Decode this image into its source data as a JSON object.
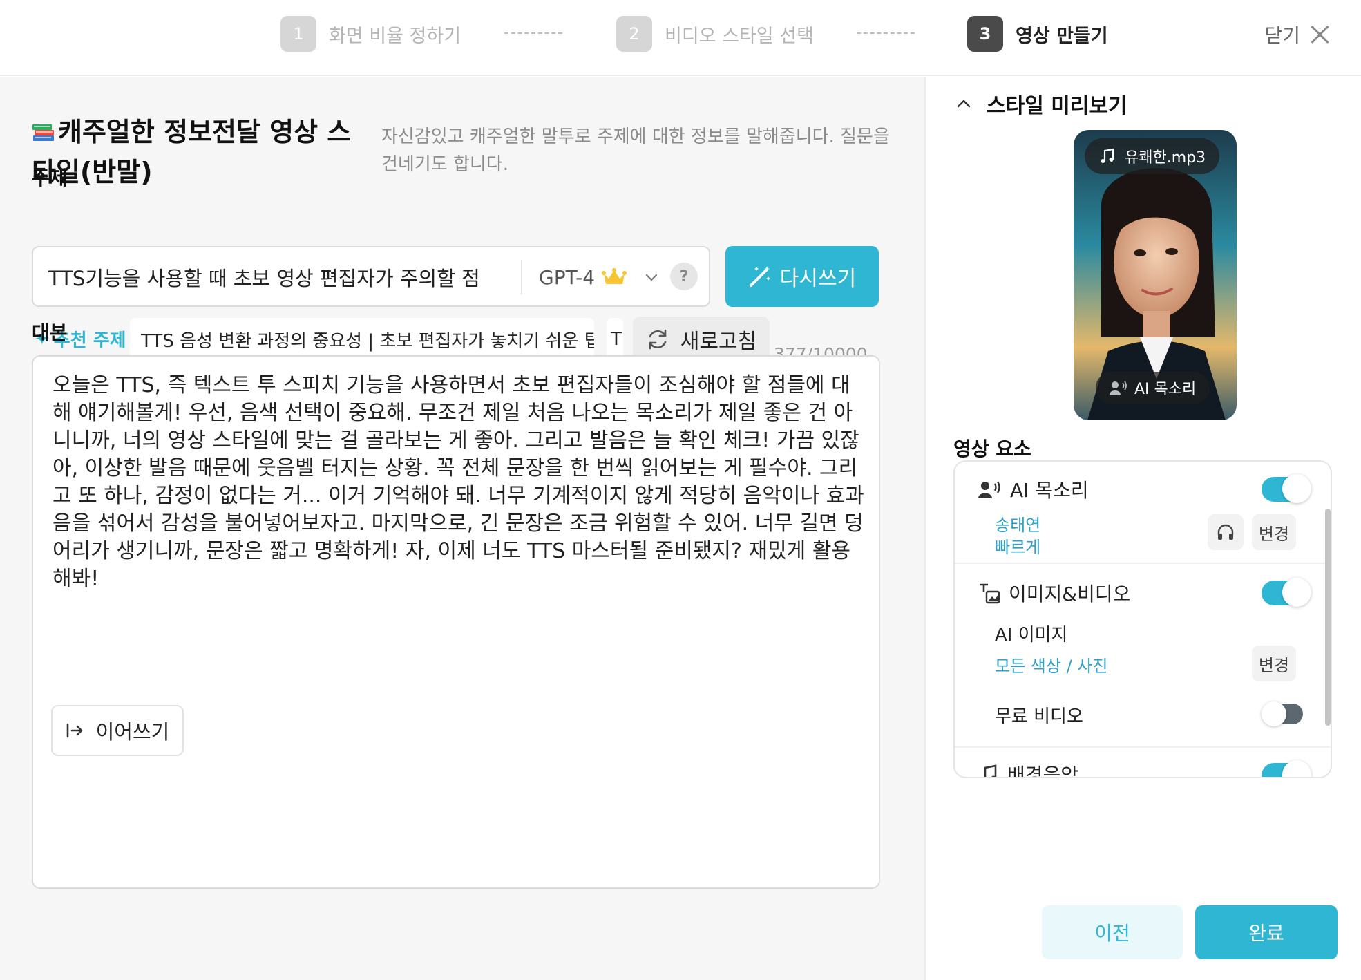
{
  "stepper": {
    "steps": [
      {
        "num": "1",
        "label": "화면 비율 정하기"
      },
      {
        "num": "2",
        "label": "비디오 스타일 선택"
      },
      {
        "num": "3",
        "label": "영상 만들기"
      }
    ],
    "active_step": 3,
    "close_label": "닫기"
  },
  "style": {
    "title": "캐주얼한 정보전달 영상 스타일(반말)",
    "description": "자신감있고 캐주얼한 말투로 주제에 대한 정보를 말해줍니다. 질문을 건네기도 합니다."
  },
  "topic": {
    "label": "주제",
    "value": "TTS기능을 사용할 때 초보 영상 편집자가 주의할 점",
    "model": "GPT-4",
    "help": "?",
    "rewrite_label": "다시쓰기"
  },
  "recommend": {
    "label": "추천 주제",
    "chips": [
      "TTS 음성 변환 과정의 중요성 | 초보 편집자가 놓치기 쉬운 팁",
      "T"
    ],
    "refresh_label": "새로고침"
  },
  "script": {
    "label": "대본",
    "counter": "377/10000",
    "text": "오늘은 TTS, 즉 텍스트 투 스피치 기능을 사용하면서 초보 편집자들이 조심해야 할 점들에 대해 얘기해볼게! 우선, 음색 선택이 중요해. 무조건 제일 처음 나오는 목소리가 제일 좋은 건 아니니까, 너의 영상 스타일에 맞는 걸 골라보는 게 좋아. 그리고 발음은 늘 확인 체크! 가끔 있잖아, 이상한 발음 때문에 웃음벨 터지는 상황. 꼭 전체 문장을 한 번씩 읽어보는 게 필수야. 그리고 또 하나, 감정이 없다는 거... 이거 기억해야 돼. 너무 기계적이지 않게 적당히 음악이나 효과음을 섞어서 감성을 불어넣어보자고. 마지막으로, 긴 문장은 조금 위험할 수 있어. 너무 길면 덩어리가 생기니까, 문장은 짧고 명확하게! 자, 이제 너도 TTS 마스터될 준비됐지? 재밌게 활용해봐!",
    "continue_label": "이어쓰기"
  },
  "preview": {
    "title": "스타일 미리보기",
    "music_pill": "유쾌한.mp3",
    "voice_pill": "AI 목소리"
  },
  "elements": {
    "title": "영상 요소",
    "ai_voice": {
      "label": "AI 목소리",
      "enabled": true,
      "voice_name": "송태연",
      "speed": "빠르게",
      "change_label": "변경"
    },
    "image_video": {
      "label": "이미지&비디오",
      "enabled": true,
      "ai_image_label": "AI 이미지",
      "ai_image_value": "모든 색상 / 사진",
      "change_label": "변경",
      "free_video_label": "무료 비디오",
      "free_video_enabled": false
    },
    "bgm": {
      "label": "배경음악",
      "enabled": true
    }
  },
  "footer": {
    "prev_label": "이전",
    "done_label": "완료"
  },
  "colors": {
    "accent": "#2fb6d2",
    "link": "#2fa0c8",
    "inactive_step": "#d6d6d6",
    "active_step": "#4a4a4a"
  }
}
